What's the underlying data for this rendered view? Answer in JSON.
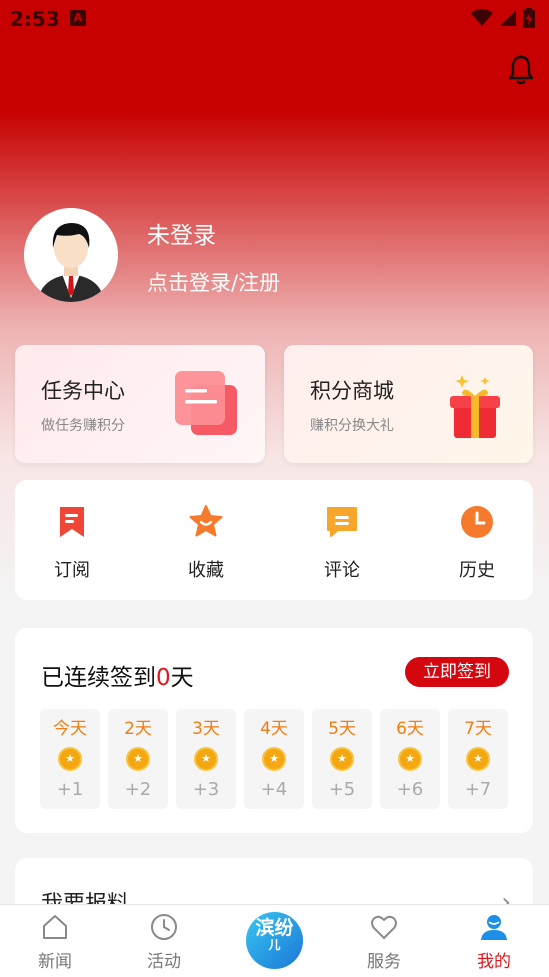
{
  "status": {
    "time": "2:53",
    "notif": "A"
  },
  "profile": {
    "name": "未登录",
    "login": "点击登录/注册"
  },
  "cards": {
    "task": {
      "title": "任务中心",
      "subtitle": "做任务赚积分"
    },
    "points": {
      "title": "积分商城",
      "subtitle": "赚积分换大礼"
    }
  },
  "quick": [
    {
      "label": "订阅",
      "icon": "bookmark-icon"
    },
    {
      "label": "收藏",
      "icon": "star-icon"
    },
    {
      "label": "评论",
      "icon": "comment-icon"
    },
    {
      "label": "历史",
      "icon": "clock-icon"
    }
  ],
  "checkin": {
    "prefix": "已连续签到",
    "count": "0",
    "suffix": "天",
    "button": "立即签到",
    "days": [
      {
        "label": "今天",
        "points": "+1"
      },
      {
        "label": "2天",
        "points": "+2"
      },
      {
        "label": "3天",
        "points": "+3"
      },
      {
        "label": "4天",
        "points": "+4"
      },
      {
        "label": "5天",
        "points": "+5"
      },
      {
        "label": "6天",
        "points": "+6"
      },
      {
        "label": "7天",
        "points": "+7"
      }
    ]
  },
  "report": {
    "title": "我要报料",
    "chevron": "›"
  },
  "tabs": [
    {
      "label": "新闻",
      "icon": "home-icon"
    },
    {
      "label": "活动",
      "icon": "clock-icon"
    },
    {
      "label": "服务",
      "icon": "heart-icon"
    },
    {
      "label": "我的",
      "icon": "person-icon"
    }
  ],
  "center_logo": {
    "line1": "滨",
    "line2": "纷",
    "line3": "儿"
  },
  "colors": {
    "brand_red": "#c70000",
    "accent": "#e0181c",
    "coin": "#f3a712"
  }
}
